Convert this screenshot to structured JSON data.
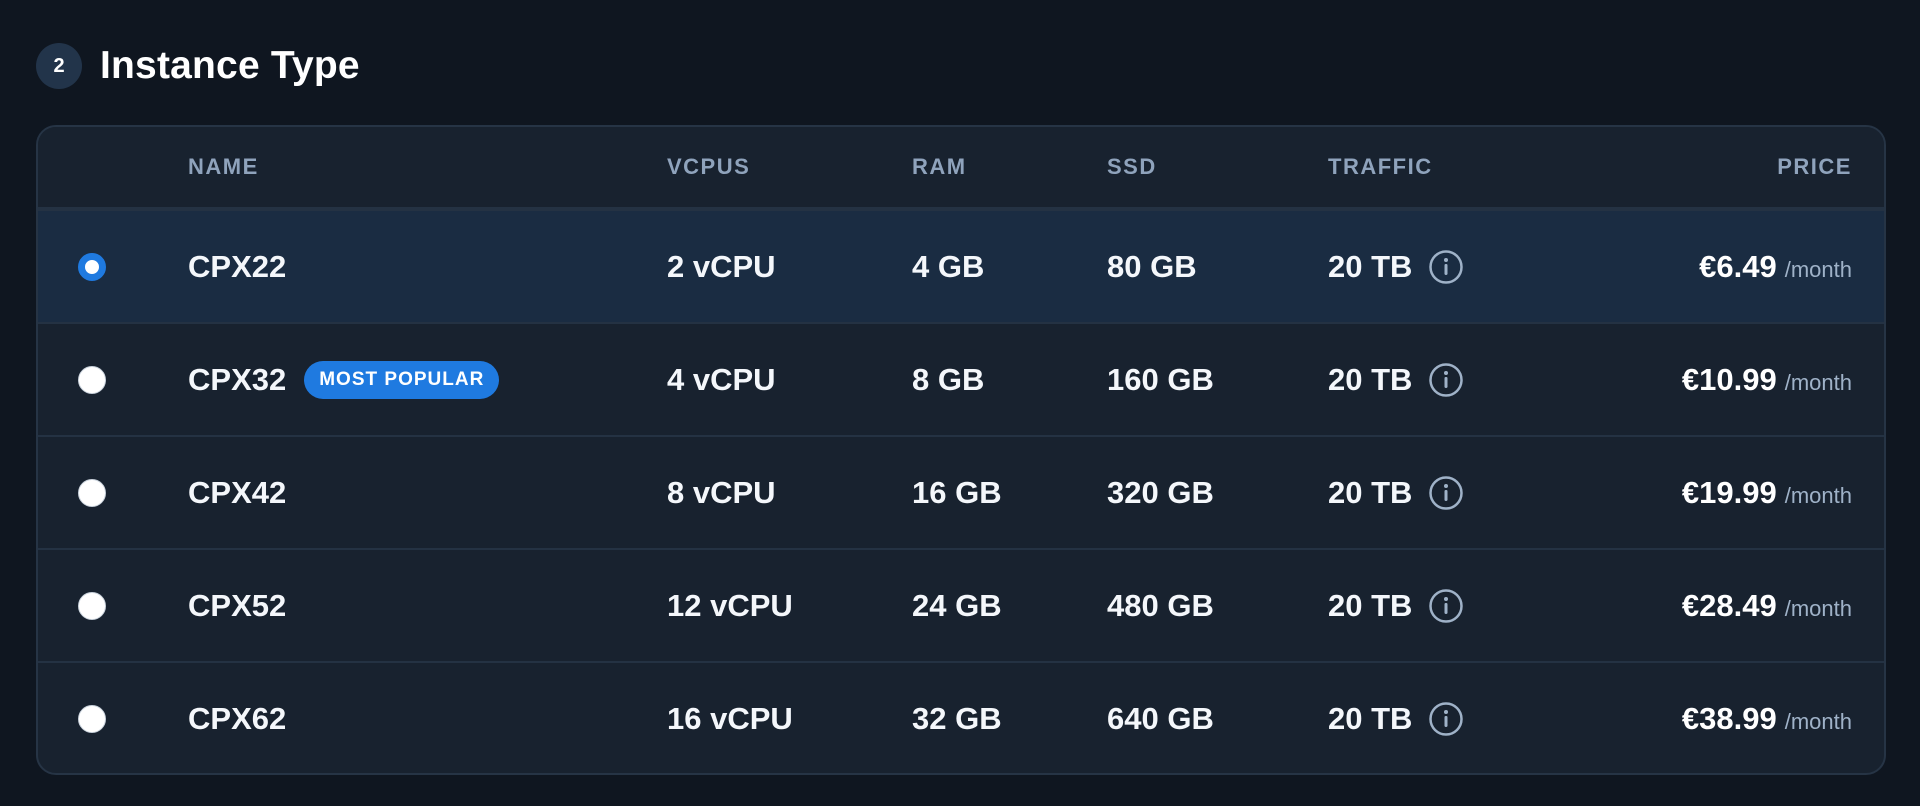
{
  "section": {
    "step": "2",
    "title": "Instance Type"
  },
  "table": {
    "columns": {
      "name": "NAME",
      "vcpus": "VCPUS",
      "ram": "RAM",
      "ssd": "SSD",
      "traffic": "TRAFFIC",
      "price": "PRICE"
    },
    "rows": [
      {
        "name": "CPX22",
        "badge": "",
        "vcpus": "2 vCPU",
        "ram": "4 GB",
        "ssd": "80 GB",
        "traffic": "20 TB",
        "price": "€6.49",
        "period": "/month",
        "selected": true
      },
      {
        "name": "CPX32",
        "badge": "MOST POPULAR",
        "vcpus": "4 vCPU",
        "ram": "8 GB",
        "ssd": "160 GB",
        "traffic": "20 TB",
        "price": "€10.99",
        "period": "/month",
        "selected": false
      },
      {
        "name": "CPX42",
        "badge": "",
        "vcpus": "8 vCPU",
        "ram": "16 GB",
        "ssd": "320 GB",
        "traffic": "20 TB",
        "price": "€19.99",
        "period": "/month",
        "selected": false
      },
      {
        "name": "CPX52",
        "badge": "",
        "vcpus": "12 vCPU",
        "ram": "24 GB",
        "ssd": "480 GB",
        "traffic": "20 TB",
        "price": "€28.49",
        "period": "/month",
        "selected": false
      },
      {
        "name": "CPX62",
        "badge": "",
        "vcpus": "16 vCPU",
        "ram": "32 GB",
        "ssd": "640 GB",
        "traffic": "20 TB",
        "price": "€38.99",
        "period": "/month",
        "selected": false
      }
    ]
  },
  "icons": {
    "info": "info-icon",
    "radio": "radio-button"
  },
  "colors": {
    "background": "#0f1620",
    "card": "#18222f",
    "selected_row": "#1a2c42",
    "accent": "#1f7ae0",
    "header_text": "#8fa3bc",
    "muted_text": "#9fb2c8"
  }
}
